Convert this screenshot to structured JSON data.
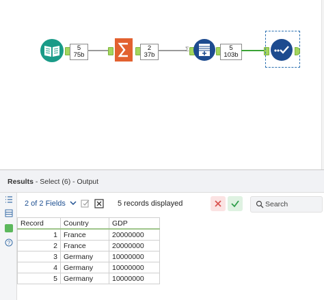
{
  "workflow": {
    "tools": [
      {
        "name": "input-data-tool",
        "icon": "book-icon",
        "color": "#1a9b88"
      },
      {
        "name": "summarize-tool",
        "icon": "sigma-icon",
        "color": "#e2612f"
      },
      {
        "name": "formula-tool",
        "icon": "table-plus-icon",
        "color": "#1d4b8f"
      },
      {
        "name": "output-tool",
        "icon": "check-dots-icon",
        "color": "#1d4b8f"
      }
    ],
    "counts": [
      {
        "records": "5",
        "size": "75b"
      },
      {
        "records": "2",
        "size": "37b"
      },
      {
        "records": "5",
        "size": "103b"
      }
    ],
    "sigma_marker": "Σ"
  },
  "results": {
    "title_bold": "Results",
    "title_rest": " - Select (6) - Output"
  },
  "toolbar": {
    "fields_label": "2 of 2 Fields",
    "records_displayed": "5 records displayed",
    "search_placeholder": "Search"
  },
  "table": {
    "headers": [
      "Record",
      "Country",
      "GDP"
    ],
    "rows": [
      [
        "1",
        "France",
        "20000000"
      ],
      [
        "2",
        "France",
        "20000000"
      ],
      [
        "3",
        "Germany",
        "10000000"
      ],
      [
        "4",
        "Germany",
        "10000000"
      ],
      [
        "5",
        "Germany",
        "10000000"
      ]
    ]
  },
  "colors": {
    "accent_green": "#a4d65e",
    "link_blue": "#1d4f91"
  }
}
